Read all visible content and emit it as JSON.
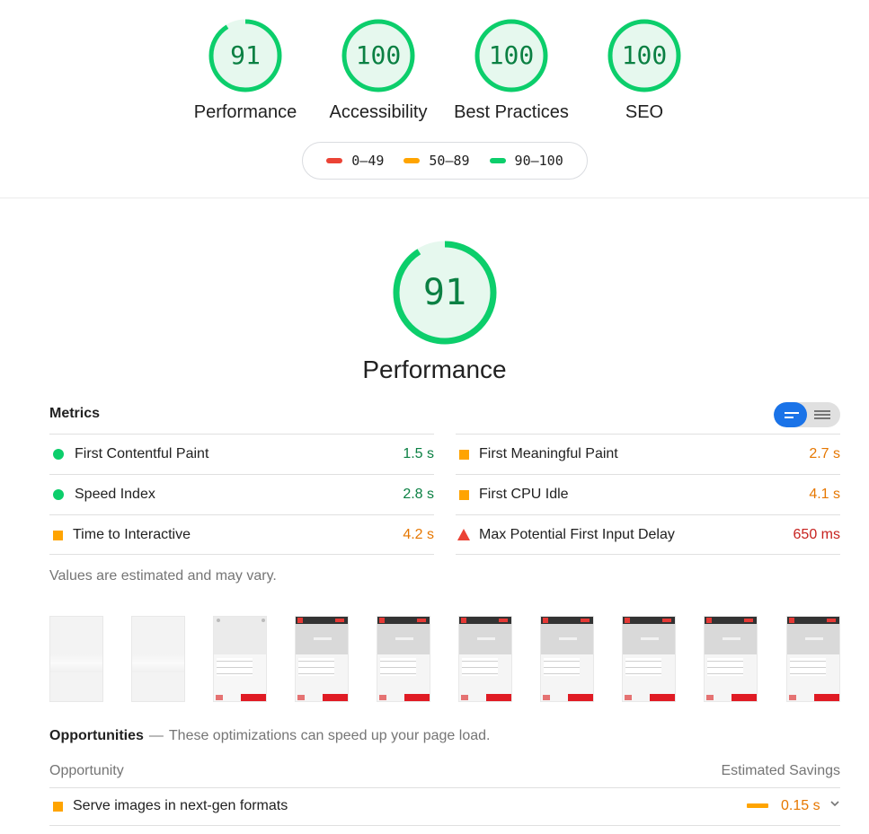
{
  "summary": {
    "gauges": [
      {
        "score": "91",
        "label": "Performance",
        "fraction": 0.91
      },
      {
        "score": "100",
        "label": "Accessibility",
        "fraction": 1.0
      },
      {
        "score": "100",
        "label": "Best Practices",
        "fraction": 1.0
      },
      {
        "score": "100",
        "label": "SEO",
        "fraction": 1.0
      }
    ],
    "legend": [
      {
        "range": "0–49",
        "color": "#eb4335"
      },
      {
        "range": "50–89",
        "color": "#ffa400"
      },
      {
        "range": "90–100",
        "color": "#0cce6b"
      }
    ]
  },
  "category": {
    "score": "91",
    "fraction": 0.91,
    "title": "Performance"
  },
  "metrics": {
    "title": "Metrics",
    "left": [
      {
        "label": "First Contentful Paint",
        "value": "1.5 s",
        "rating": "pass"
      },
      {
        "label": "Speed Index",
        "value": "2.8 s",
        "rating": "pass"
      },
      {
        "label": "Time to Interactive",
        "value": "4.2 s",
        "rating": "average"
      }
    ],
    "right": [
      {
        "label": "First Meaningful Paint",
        "value": "2.7 s",
        "rating": "average"
      },
      {
        "label": "First CPU Idle",
        "value": "4.1 s",
        "rating": "average"
      },
      {
        "label": "Max Potential First Input Delay",
        "value": "650 ms",
        "rating": "fail"
      }
    ],
    "note": "Values are estimated and may vary."
  },
  "colors": {
    "pass": "#0cce6b",
    "average": "#ffa400",
    "fail": "#eb4335",
    "toggle_active": "#1a73e8"
  },
  "filmstrip": {
    "frame_count": 10
  },
  "opportunities": {
    "title": "Opportunities",
    "dash": "—",
    "description": "These optimizations can speed up your page load.",
    "col_opportunity": "Opportunity",
    "col_savings": "Estimated Savings",
    "items": [
      {
        "label": "Serve images in next-gen formats",
        "savings": "0.15 s"
      }
    ]
  }
}
